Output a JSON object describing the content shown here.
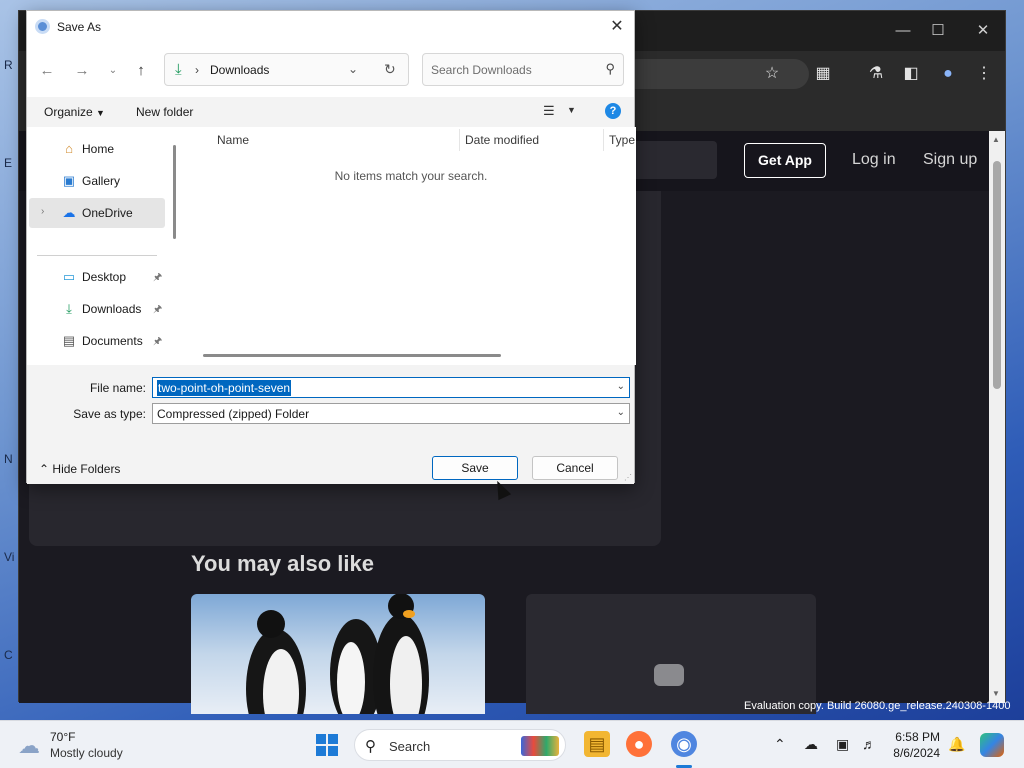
{
  "desktop": {
    "side_letters": [
      "R",
      "E",
      "N",
      "Vi",
      "C"
    ]
  },
  "browser": {
    "header": {
      "get_app": "Get App",
      "login": "Log in",
      "signup": "Sign up"
    },
    "section_title": "You may also like",
    "watermark": "Evaluation copy. Build 26080.ge_release.240308-1400"
  },
  "dialog": {
    "title": "Save As",
    "address": {
      "location": "Downloads"
    },
    "search": {
      "placeholder": "Search Downloads"
    },
    "commands": {
      "organize": "Organize",
      "new_folder": "New folder"
    },
    "nav_items": [
      {
        "label": "Home",
        "icon": "home-icon"
      },
      {
        "label": "Gallery",
        "icon": "gallery-icon"
      },
      {
        "label": "OneDrive",
        "icon": "cloud-icon"
      },
      {
        "label": "Desktop",
        "icon": "desktop-icon"
      },
      {
        "label": "Downloads",
        "icon": "download-icon"
      },
      {
        "label": "Documents",
        "icon": "document-icon"
      }
    ],
    "columns": {
      "name": "Name",
      "date_modified": "Date modified",
      "type": "Type"
    },
    "empty_message": "No items match your search.",
    "form": {
      "file_name_label": "File name:",
      "file_name_value": "two-point-oh-point-seven",
      "save_type_label": "Save as type:",
      "save_type_value": "Compressed (zipped) Folder"
    },
    "hide_folders": "Hide Folders",
    "save_button": "Save",
    "cancel_button": "Cancel",
    "accent_color": "#0067c0"
  },
  "taskbar": {
    "weather": {
      "temp": "70°F",
      "condition": "Mostly cloudy"
    },
    "search_label": "Search",
    "clock": {
      "time": "6:58 PM",
      "date": "8/6/2024"
    }
  }
}
